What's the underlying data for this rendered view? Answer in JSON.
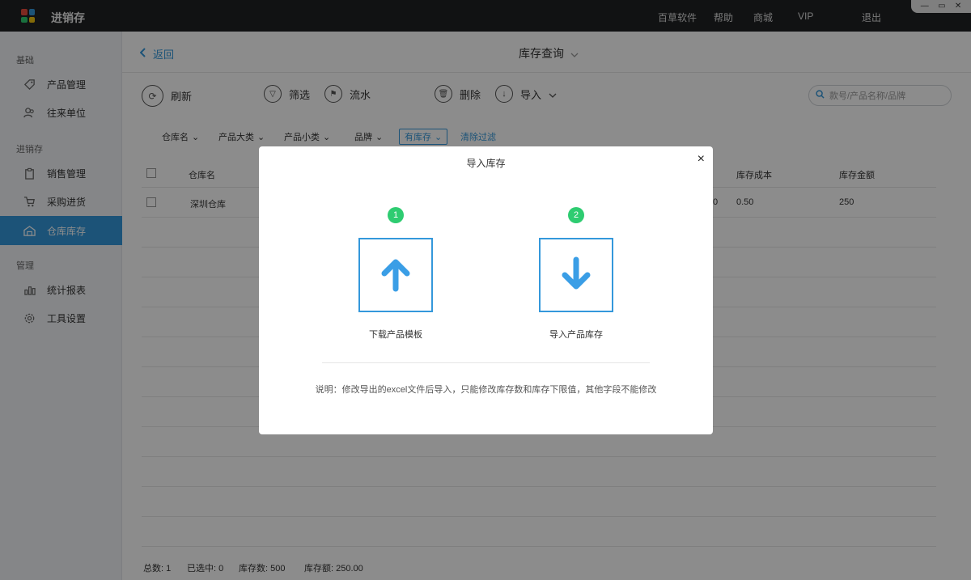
{
  "titlebar": {
    "app_title": "进销存",
    "nav": [
      "百草软件",
      "帮助",
      "商城",
      "VIP",
      "退出"
    ],
    "logo_colors": [
      "#e74c3c",
      "#3498db",
      "#2ecc71",
      "#f1c40f"
    ]
  },
  "sidebar": {
    "groups": [
      {
        "label": "基础",
        "items": [
          {
            "label": "产品管理",
            "icon": "tag-icon"
          },
          {
            "label": "往来单位",
            "icon": "users-icon"
          }
        ]
      },
      {
        "label": "进销存",
        "items": [
          {
            "label": "销售管理",
            "icon": "clipboard-icon"
          },
          {
            "label": "采购进货",
            "icon": "cart-icon"
          },
          {
            "label": "仓库库存",
            "icon": "warehouse-icon",
            "active": true
          }
        ]
      },
      {
        "label": "管理",
        "items": [
          {
            "label": "统计报表",
            "icon": "chart-icon"
          },
          {
            "label": "工具设置",
            "icon": "gear-icon"
          }
        ]
      }
    ]
  },
  "header": {
    "back_label": "返回",
    "title": "库存查询"
  },
  "toolbar": {
    "refresh": "刷新",
    "filter": "筛选",
    "flow": "流水",
    "delete": "删除",
    "import": "导入",
    "search_placeholder": "款号/产品名称/品牌"
  },
  "filters": {
    "warehouse": "仓库名",
    "category_major": "产品大类",
    "category_minor": "产品小类",
    "brand": "品牌",
    "in_stock": "有库存",
    "clear": "清除过滤"
  },
  "table": {
    "columns": {
      "warehouse": "仓库名",
      "cost": "库存成本",
      "amount": "库存金额"
    },
    "rows": [
      {
        "warehouse": "深圳仓库",
        "partial": "0",
        "cost": "0.50",
        "amount": "250"
      }
    ]
  },
  "footer": {
    "total_label": "总数:",
    "total": "1",
    "selected_label": "已选中:",
    "selected": "0",
    "stock_qty_label": "库存数:",
    "stock_qty": "500",
    "stock_value_label": "库存额:",
    "stock_value": "250.00"
  },
  "modal": {
    "title": "导入库存",
    "close": "×",
    "step1": {
      "number": "1",
      "label": "下载产品模板"
    },
    "step2": {
      "number": "2",
      "label": "导入产品库存"
    },
    "note": "说明：修改导出的excel文件后导入，只能修改库存数和库存下限值，其他字段不能修改"
  }
}
